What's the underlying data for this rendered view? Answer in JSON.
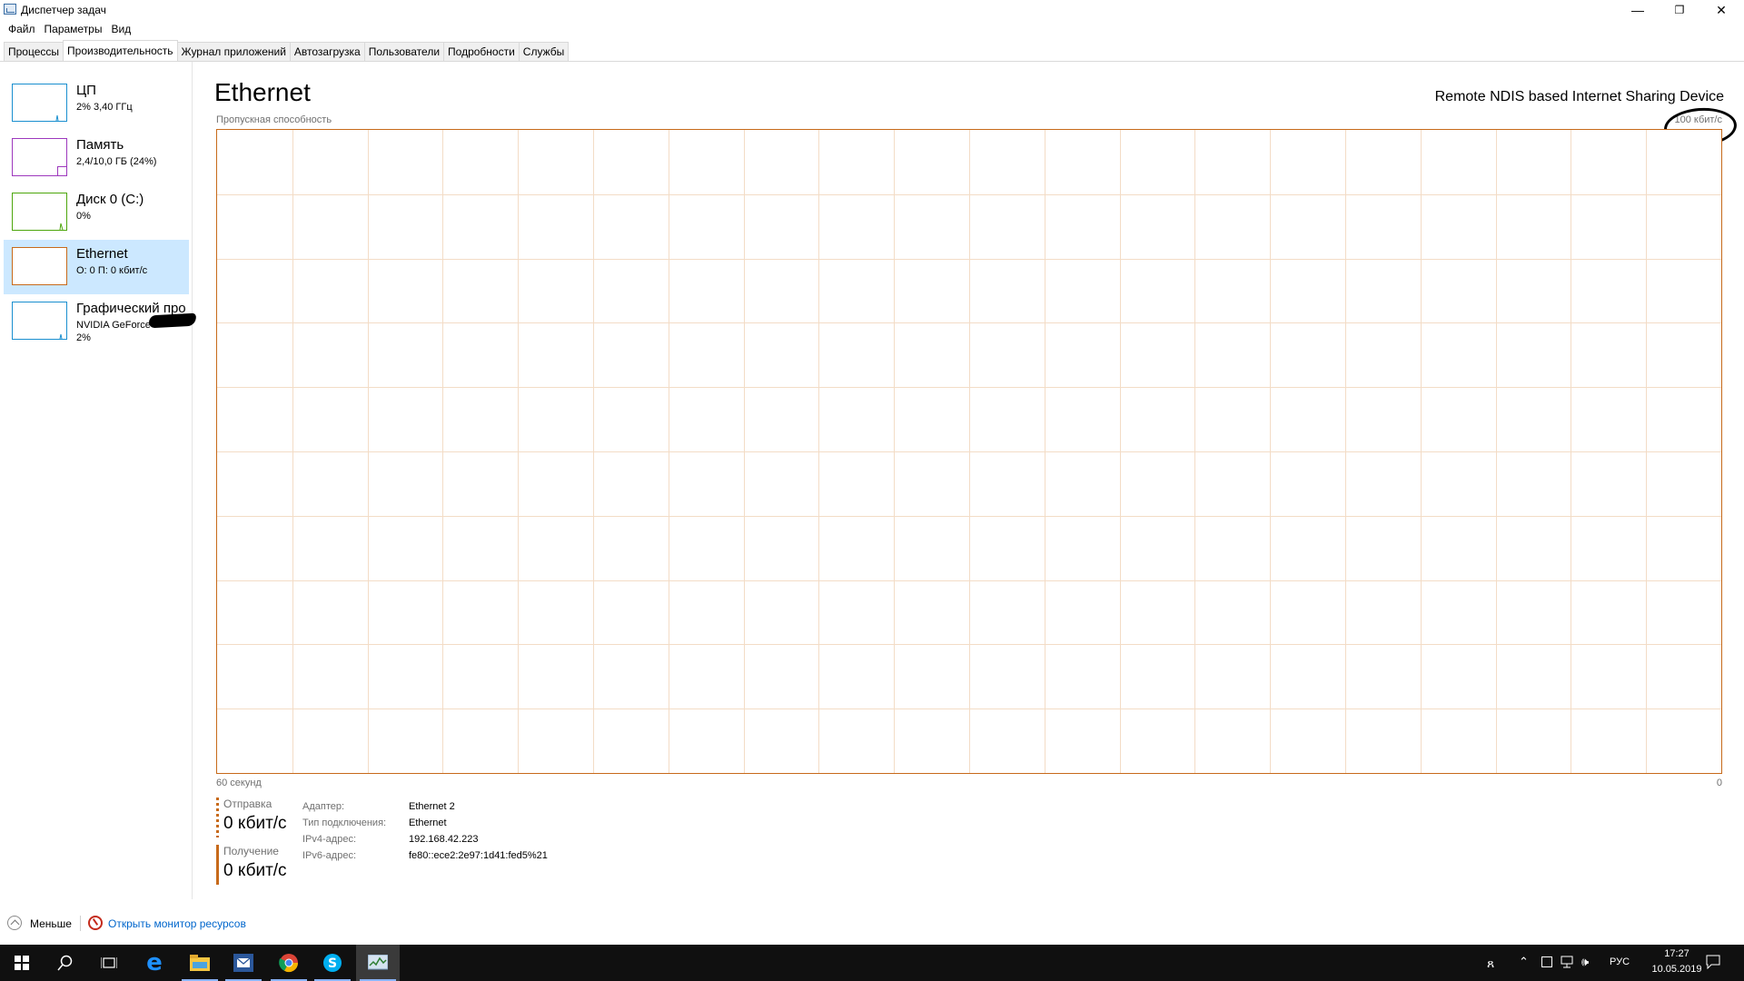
{
  "window": {
    "title": "Диспетчер задач",
    "minimize_glyph": "—",
    "maximize_glyph": "❐",
    "close_glyph": "✕"
  },
  "menu": [
    "Файл",
    "Параметры",
    "Вид"
  ],
  "tabs": [
    {
      "label": "Процессы",
      "active": false
    },
    {
      "label": "Производительность",
      "active": true
    },
    {
      "label": "Журнал приложений",
      "active": false
    },
    {
      "label": "Автозагрузка",
      "active": false
    },
    {
      "label": "Пользователи",
      "active": false
    },
    {
      "label": "Подробности",
      "active": false
    },
    {
      "label": "Службы",
      "active": false
    }
  ],
  "sidebar": {
    "items": [
      {
        "title": "ЦП",
        "sub": "2% 3,40 ГГц",
        "sub2": "",
        "color": "#1a8fcf",
        "icon": "cpu-graph-icon"
      },
      {
        "title": "Память",
        "sub": "2,4/10,0 ГБ (24%)",
        "sub2": "",
        "color": "#9d38bd",
        "icon": "memory-graph-icon"
      },
      {
        "title": "Диск 0 (C:)",
        "sub": "0%",
        "sub2": "",
        "color": "#4da60c",
        "icon": "disk-graph-icon"
      },
      {
        "title": "Ethernet",
        "sub": "О: 0 П: 0 кбит/с",
        "sub2": "",
        "color": "#c76a1a",
        "icon": "ethernet-graph-icon",
        "active": true
      },
      {
        "title": "Графический про",
        "sub": "NVIDIA GeForce",
        "sub2": "2%",
        "color": "#1a8fcf",
        "icon": "gpu-graph-icon"
      }
    ]
  },
  "main": {
    "title": "Ethernet",
    "device": "Remote NDIS based Internet Sharing Device",
    "graph_label_left": "Пропускная способность",
    "graph_label_right": "100 кбит/с",
    "graph_foot_left": "60 секунд",
    "graph_foot_right": "0",
    "graph_color": "#c76a1a",
    "send_label": "Отправка",
    "send_value": "0 кбит/с",
    "recv_label": "Получение",
    "recv_value": "0 кбит/с",
    "info": [
      {
        "key": "Адаптер:",
        "value": "Ethernet 2"
      },
      {
        "key": "Тип подключения:",
        "value": "Ethernet"
      },
      {
        "key": "IPv4-адрес:",
        "value": "192.168.42.223"
      },
      {
        "key": "IPv6-адрес:",
        "value": "fe80::ece2:2e97:1d41:fed5%21"
      }
    ]
  },
  "footer": {
    "less_label": "Меньше",
    "monitor_label": "Открыть монитор ресурсов"
  },
  "taskbar": {
    "apps": [
      "windows-start-icon",
      "search-icon",
      "task-view-icon",
      "edge-icon",
      "file-explorer-icon",
      "mail-app-icon",
      "chrome-icon",
      "skype-icon",
      "task-manager-icon"
    ],
    "lang": "РУС",
    "time": "17:27",
    "date": "10.05.2019"
  }
}
